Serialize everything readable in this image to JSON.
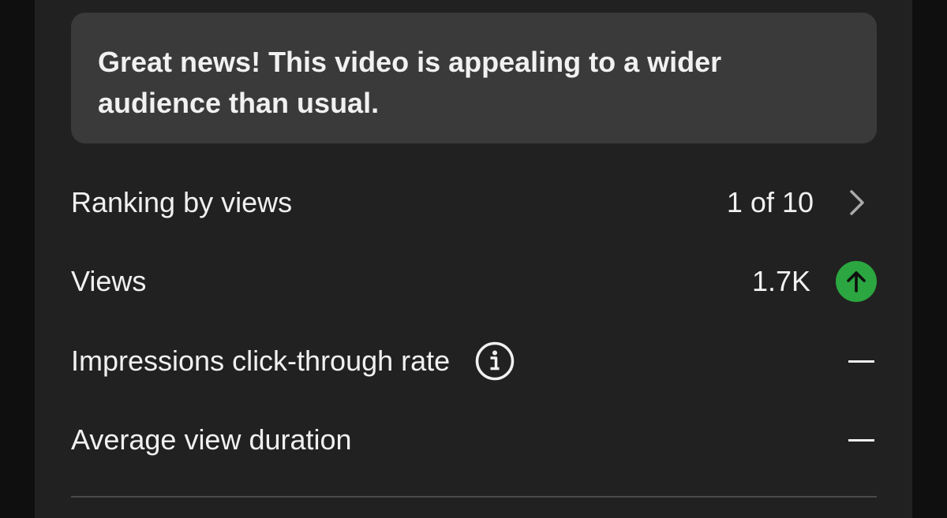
{
  "banner": {
    "message": "Great news! This video is appealing to a wider audience than usual."
  },
  "metrics": {
    "ranking": {
      "label": "Ranking by views",
      "value": "1 of 10"
    },
    "views": {
      "label": "Views",
      "value": "1.7K",
      "trend": "up",
      "trend_color": "#2ba640"
    },
    "ctr": {
      "label": "Impressions click-through rate",
      "value": "—"
    },
    "avd": {
      "label": "Average view duration",
      "value": "—"
    }
  },
  "icons": {
    "chevron": "chevron-right-icon",
    "trend": "arrow-up-icon",
    "info": "info-icon"
  }
}
